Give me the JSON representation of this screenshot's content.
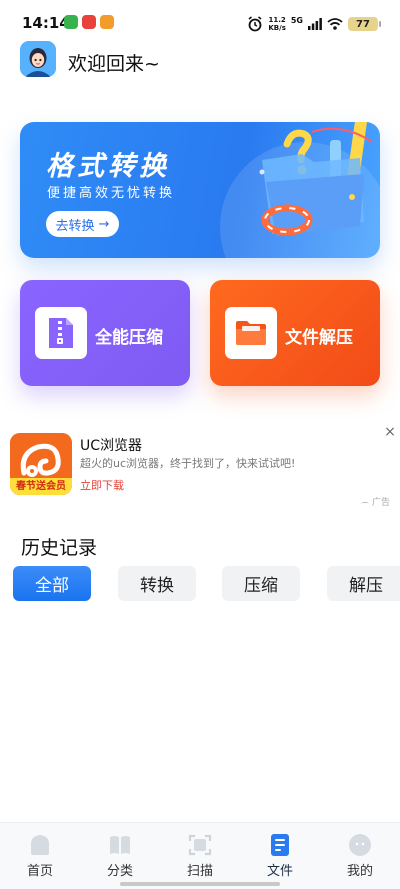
{
  "status_bar": {
    "time": "14:14",
    "net_speed_value": "11.2",
    "net_speed_unit": "KB/s",
    "network": "5G",
    "battery": "77"
  },
  "header": {
    "welcome": "欢迎回来~"
  },
  "hero": {
    "title": "格式转换",
    "subtitle": "便捷高效无忧转换",
    "button_label": "去转换",
    "button_arrow": "→"
  },
  "features": [
    {
      "label": "全能压缩",
      "icon": "zip-file-icon",
      "color": "#8a64ff"
    },
    {
      "label": "文件解压",
      "icon": "folder-icon",
      "color": "#f5541c"
    }
  ],
  "ad": {
    "title": "UC浏览器",
    "description": "超火的uc浏览器，终于找到了，快来试试吧!",
    "cta": "立即下载",
    "logo_band": "春节送会员",
    "close": "×",
    "tag": "广告"
  },
  "history": {
    "title": "历史记录",
    "tabs": [
      "全部",
      "转换",
      "压缩",
      "解压"
    ],
    "active_tab": "全部"
  },
  "bottom_nav": [
    {
      "label": "首页",
      "icon": "home-icon"
    },
    {
      "label": "分类",
      "icon": "book-icon"
    },
    {
      "label": "扫描",
      "icon": "scan-icon"
    },
    {
      "label": "文件",
      "icon": "file-icon",
      "active": true
    },
    {
      "label": "我的",
      "icon": "profile-icon"
    }
  ],
  "colors": {
    "primary_blue": "#2a7af0",
    "compress_purple": "#8a64ff",
    "extract_orange": "#f5541c",
    "ad_cta_red": "#e0453b"
  }
}
